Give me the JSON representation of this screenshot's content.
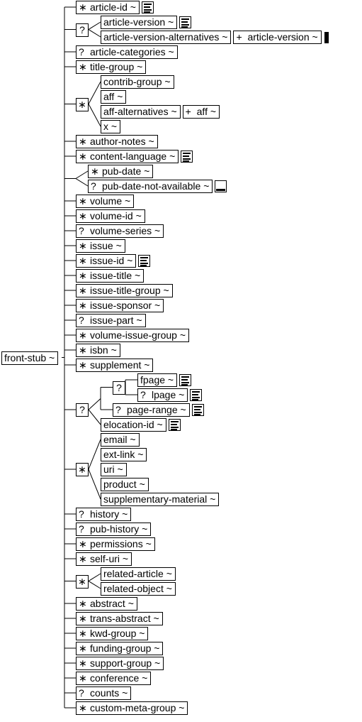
{
  "root": {
    "label": "front-stub ~"
  },
  "compositors": [
    {
      "symbol": "?",
      "kind": "choice"
    },
    {
      "symbol": "∗",
      "kind": "choice"
    },
    {
      "symbol": "",
      "kind": "choice"
    },
    {
      "symbol": "?",
      "kind": "choice"
    },
    {
      "symbol": "?",
      "kind": "sequence"
    },
    {
      "symbol": "∗",
      "kind": "choice"
    },
    {
      "symbol": "∗",
      "kind": "choice"
    }
  ],
  "nodes": [
    {
      "label": "article-id ~",
      "occ": "∗",
      "icon": "text-content-icon"
    },
    {
      "label": "article-version ~",
      "occ": "",
      "icon": "text-content-icon"
    },
    {
      "label": "article-version-alternatives ~",
      "occ": "",
      "child": {
        "occ": "+",
        "label": "article-version ~"
      },
      "icon": "filled-bar-icon"
    },
    {
      "label": "article-categories ~",
      "occ": "?"
    },
    {
      "label": "title-group ~",
      "occ": "∗"
    },
    {
      "label": "contrib-group ~",
      "occ": ""
    },
    {
      "label": "aff ~",
      "occ": ""
    },
    {
      "label": "aff-alternatives ~",
      "occ": "",
      "child": {
        "occ": "+",
        "label": "aff ~"
      }
    },
    {
      "label": "x ~",
      "occ": ""
    },
    {
      "label": "author-notes ~",
      "occ": "∗"
    },
    {
      "label": "content-language ~",
      "occ": "∗",
      "icon": "text-content-icon"
    },
    {
      "label": "pub-date ~",
      "occ": "∗"
    },
    {
      "label": "pub-date-not-available ~",
      "occ": "?",
      "icon": "empty-element-icon"
    },
    {
      "label": "volume ~",
      "occ": "∗"
    },
    {
      "label": "volume-id ~",
      "occ": "∗"
    },
    {
      "label": "volume-series ~",
      "occ": "?"
    },
    {
      "label": "issue ~",
      "occ": "∗"
    },
    {
      "label": "issue-id ~",
      "occ": "∗",
      "icon": "text-content-icon"
    },
    {
      "label": "issue-title ~",
      "occ": "∗"
    },
    {
      "label": "issue-title-group ~",
      "occ": "∗"
    },
    {
      "label": "issue-sponsor ~",
      "occ": "∗"
    },
    {
      "label": "issue-part ~",
      "occ": "?"
    },
    {
      "label": "volume-issue-group ~",
      "occ": "∗"
    },
    {
      "label": "isbn ~",
      "occ": "∗"
    },
    {
      "label": "supplement ~",
      "occ": "∗"
    },
    {
      "label": "fpage ~",
      "occ": "",
      "icon": "text-content-icon"
    },
    {
      "label": "lpage ~",
      "occ": "?",
      "icon": "text-content-icon"
    },
    {
      "label": "page-range ~",
      "occ": "?",
      "icon": "text-content-icon"
    },
    {
      "label": "elocation-id ~",
      "occ": "",
      "icon": "text-content-icon"
    },
    {
      "label": "email ~",
      "occ": ""
    },
    {
      "label": "ext-link ~",
      "occ": ""
    },
    {
      "label": "uri ~",
      "occ": ""
    },
    {
      "label": "product ~",
      "occ": ""
    },
    {
      "label": "supplementary-material ~",
      "occ": ""
    },
    {
      "label": "history ~",
      "occ": "?"
    },
    {
      "label": "pub-history ~",
      "occ": "?"
    },
    {
      "label": "permissions ~",
      "occ": "∗"
    },
    {
      "label": "self-uri ~",
      "occ": "∗"
    },
    {
      "label": "related-article ~",
      "occ": ""
    },
    {
      "label": "related-object ~",
      "occ": ""
    },
    {
      "label": "abstract ~",
      "occ": "∗"
    },
    {
      "label": "trans-abstract ~",
      "occ": "∗"
    },
    {
      "label": "kwd-group ~",
      "occ": "∗"
    },
    {
      "label": "funding-group ~",
      "occ": "∗"
    },
    {
      "label": "support-group ~",
      "occ": "∗"
    },
    {
      "label": "conference ~",
      "occ": "∗"
    },
    {
      "label": "counts ~",
      "occ": "?"
    },
    {
      "label": "custom-meta-group ~",
      "occ": "∗"
    }
  ]
}
